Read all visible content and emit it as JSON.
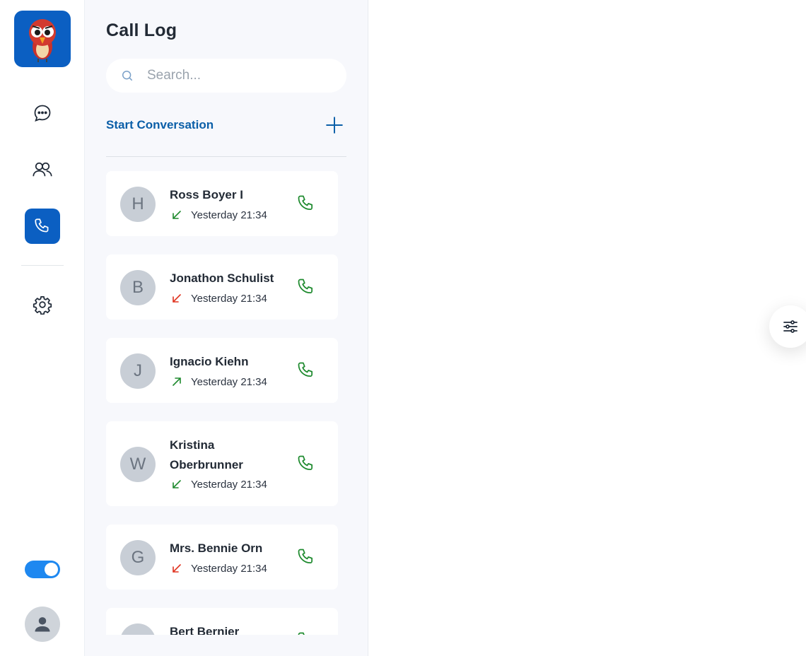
{
  "sidebar": {
    "logo_icon": "parrot-logo-icon",
    "nav": [
      {
        "name": "chats",
        "icon": "chat-bubble-icon",
        "active": false
      },
      {
        "name": "contacts",
        "icon": "users-icon",
        "active": false
      },
      {
        "name": "calls",
        "icon": "phone-icon",
        "active": true
      },
      {
        "name": "settings",
        "icon": "gear-icon",
        "active": false
      }
    ],
    "theme_toggle_on": true,
    "user_icon": "user-icon"
  },
  "panel": {
    "title": "Call Log",
    "search_placeholder": "Search...",
    "start_conversation_label": "Start Conversation"
  },
  "calls": [
    {
      "initial": "H",
      "name": "Ross Boyer I",
      "time": "Yesterday 21:34",
      "direction": "incoming",
      "status_color": "#1e8a2e"
    },
    {
      "initial": "B",
      "name": "Jonathon Schulist",
      "time": "Yesterday 21:34",
      "direction": "missed",
      "status_color": "#e0321f"
    },
    {
      "initial": "J",
      "name": "Ignacio Kiehn",
      "time": "Yesterday 21:34",
      "direction": "outgoing",
      "status_color": "#1e8a2e"
    },
    {
      "initial": "W",
      "name": "Kristina Oberbrunner",
      "time": "Yesterday 21:34",
      "direction": "incoming",
      "status_color": "#1e8a2e"
    },
    {
      "initial": "G",
      "name": "Mrs. Bennie Orn",
      "time": "Yesterday 21:34",
      "direction": "missed",
      "status_color": "#e0321f"
    },
    {
      "initial": "",
      "name": "Bert Bernier",
      "time": "",
      "direction": "incoming",
      "status_color": "#1e8a2e"
    }
  ],
  "colors": {
    "brand": "#0b5fc2",
    "accent_link": "#0b5fa8",
    "call_green": "#1e8a2e",
    "missed_red": "#e0321f"
  },
  "floating_button_icon": "sliders-icon"
}
